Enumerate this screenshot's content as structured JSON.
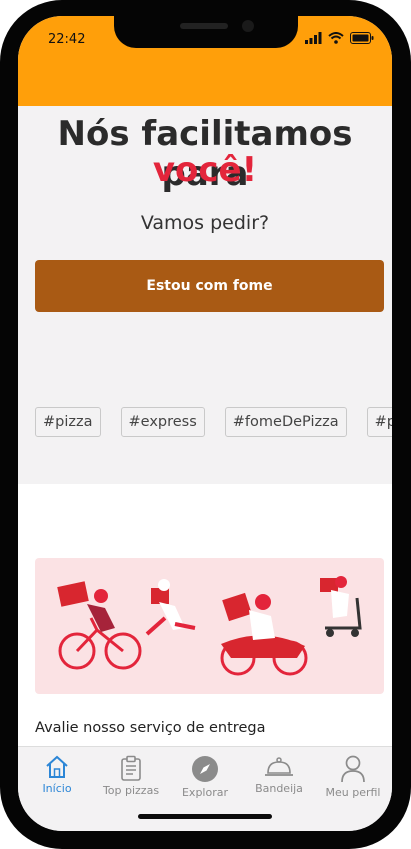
{
  "status_bar": {
    "time": "22:42"
  },
  "hero": {
    "title_line1": "Nós facilitamos para",
    "title_line2": "você!",
    "subtitle": "Vamos pedir?",
    "cta_label": "Estou com fome"
  },
  "tags": [
    "#pizza",
    "#express",
    "#fomeDePizza",
    "#pizza"
  ],
  "delivery": {
    "rate_label": "Avalie nosso serviço de entrega"
  },
  "tabbar": {
    "items": [
      {
        "label": "Início",
        "icon": "home-icon",
        "active": true
      },
      {
        "label": "Top pizzas",
        "icon": "clipboard-icon",
        "active": false
      },
      {
        "label": "Explorar",
        "icon": "compass-icon",
        "active": false
      },
      {
        "label": "Bandeija",
        "icon": "cloche-icon",
        "active": false
      },
      {
        "label": "Meu perfil",
        "icon": "profile-icon",
        "active": false
      }
    ]
  },
  "colors": {
    "header": "#ff9f0a",
    "accent_red": "#e3253b",
    "cta": "#a95a14",
    "active_tab": "#2c86d6"
  }
}
